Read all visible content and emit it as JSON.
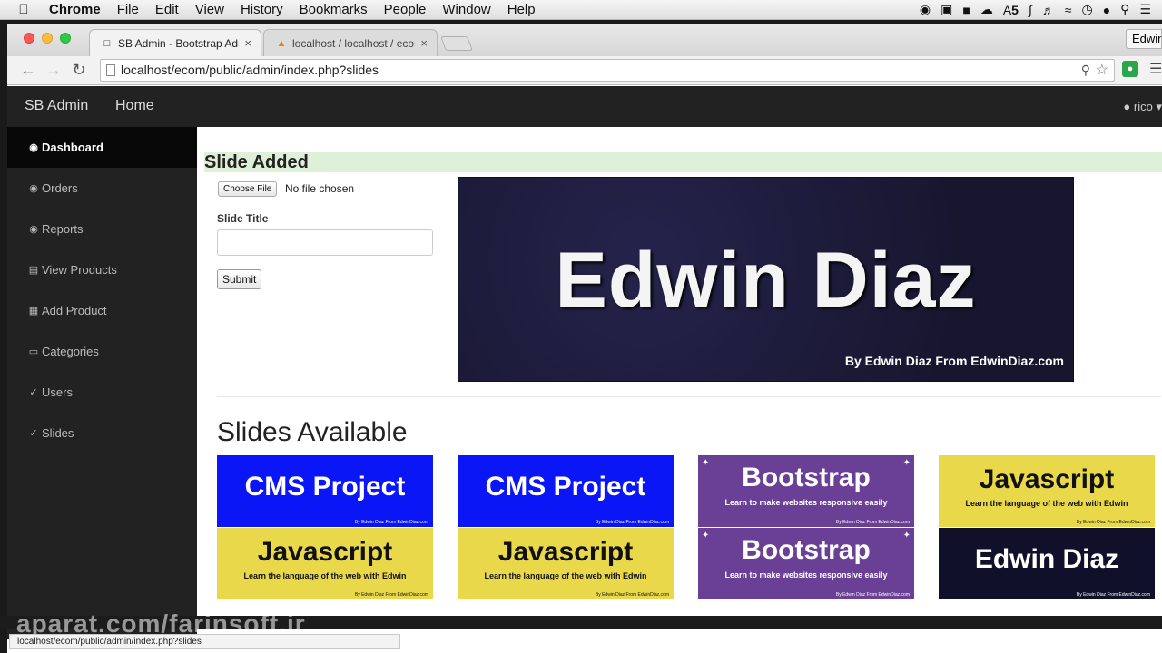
{
  "menubar": {
    "apple": "",
    "app": "Chrome",
    "items": [
      "File",
      "Edit",
      "View",
      "History",
      "Bookmarks",
      "People",
      "Window",
      "Help"
    ],
    "status_a5": "5"
  },
  "browser": {
    "tabs": [
      {
        "title": "SB Admin - Bootstrap Adm",
        "close": "×"
      },
      {
        "title": "localhost / localhost / ecom",
        "close": "×"
      }
    ],
    "profile": "Edwin",
    "url": "localhost/ecom/public/admin/index.php?slides",
    "status_url": "localhost/ecom/public/admin/index.php?slides"
  },
  "topnav": {
    "brand": "SB Admin",
    "home": "Home",
    "user": "rico"
  },
  "sidebar": {
    "items": [
      {
        "label": "Dashboard",
        "icon": "dashboard-icon"
      },
      {
        "label": "Orders",
        "icon": "dashboard-icon"
      },
      {
        "label": "Reports",
        "icon": "dashboard-icon"
      },
      {
        "label": "View Products",
        "icon": "bar-chart-icon"
      },
      {
        "label": "Add Product",
        "icon": "table-icon"
      },
      {
        "label": "Categories",
        "icon": "desktop-icon"
      },
      {
        "label": "Users",
        "icon": "wrench-icon"
      },
      {
        "label": "Slides",
        "icon": "wrench-icon"
      }
    ]
  },
  "main": {
    "alert": "Slide Added",
    "file_button": "Choose File",
    "file_status": "No file chosen",
    "slide_title_label": "Slide Title",
    "slide_title_value": "",
    "submit": "Submit",
    "preview": {
      "title": "Edwin Diaz",
      "byline": "By Edwin Diaz From EdwinDiaz.com"
    },
    "section_title": "Slides Available",
    "thumbnails": [
      {
        "top": {
          "title": "CMS Project",
          "sub": "",
          "by": "By Edwin Diaz From EdwinDiaz.com"
        },
        "bottom": {
          "title": "Javascript",
          "sub": "Learn the language of the web with Edwin",
          "by": "By Edwin Diaz From EdwinDiaz.com"
        }
      },
      {
        "top": {
          "title": "CMS Project",
          "sub": "",
          "by": "By Edwin Diaz From EdwinDiaz.com"
        },
        "bottom": {
          "title": "Javascript",
          "sub": "Learn the language of the web with Edwin",
          "by": "By Edwin Diaz From EdwinDiaz.com"
        }
      },
      {
        "top": {
          "title": "Bootstrap",
          "sub": "Learn to make websites responsive easily",
          "by": "By Edwin Diaz From EdwinDiaz.com"
        },
        "bottom": {
          "title": "Bootstrap",
          "sub": "Learn to make websites responsive easily",
          "by": "By Edwin Diaz From EdwinDiaz.com"
        }
      },
      {
        "top": {
          "title": "Javascript",
          "sub": "Learn the language of the web with Edwin",
          "by": "By Edwin Diaz From EdwinDiaz.com"
        },
        "bottom": {
          "title": "Edwin Diaz",
          "sub": "",
          "by": "By Edwin Diaz From EdwinDiaz.com"
        }
      }
    ]
  },
  "watermark": "aparat.com/farinsoft.ir",
  "colors": {
    "nav_bg": "#222222",
    "active_item": "#080808",
    "alert_bg": "#dff0d8",
    "blue_slide": "#0a16f5",
    "yellow_slide": "#e9d94a",
    "purple_slide": "#6a3f96",
    "dark_slide": "#10102a"
  }
}
